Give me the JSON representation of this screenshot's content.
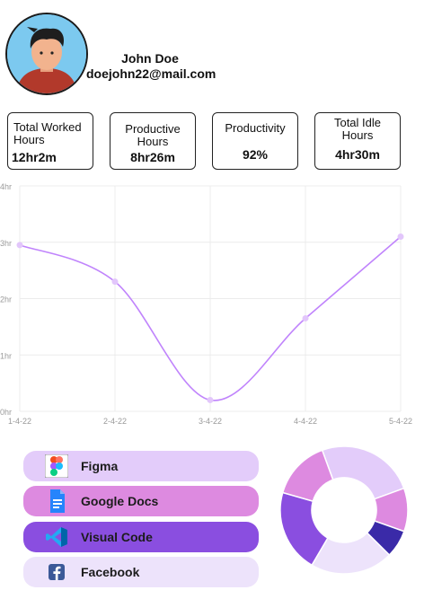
{
  "profile": {
    "name": "John Doe",
    "email": "doejohn22@mail.com",
    "avatar_icon": "avatar-man-icon"
  },
  "stats": [
    {
      "label": "Total Worked Hours",
      "value": "12hr2m"
    },
    {
      "label": "Productive Hours",
      "value": "8hr26m"
    },
    {
      "label": "Productivity",
      "value": "92%"
    },
    {
      "label": "Total Idle Hours",
      "value": "4hr30m"
    }
  ],
  "chart_data": {
    "type": "line",
    "x": [
      "1-4-22",
      "2-4-22",
      "3-4-22",
      "4-4-22",
      "5-4-22"
    ],
    "y_tick_labels": [
      "0hr",
      "1hr",
      "2hr",
      "3hr",
      "4hr"
    ],
    "ylim": [
      0,
      4
    ],
    "series": [
      {
        "values": [
          2.95,
          2.3,
          0.2,
          1.65,
          3.1
        ],
        "color": "#c084fc"
      }
    ],
    "grid": true
  },
  "apps": [
    {
      "name": "Figma",
      "icon": "figma-icon",
      "color": "#e3ccfa"
    },
    {
      "name": "Google Docs",
      "icon": "google-docs-icon",
      "color": "#dd8ae0"
    },
    {
      "name": "Visual Code",
      "icon": "visual-code-icon",
      "color": "#8a4ee0"
    },
    {
      "name": "Facebook",
      "icon": "facebook-icon",
      "color": "#ede3fb"
    }
  ],
  "donut_data": {
    "type": "pie",
    "slices": [
      {
        "value": 25,
        "color": "#e3ccfa"
      },
      {
        "value": 11,
        "color": "#dd8ae0"
      },
      {
        "value": 7,
        "color": "#3a2aa8"
      },
      {
        "value": 21,
        "color": "#ede3fb"
      },
      {
        "value": 21,
        "color": "#8a4ee0"
      },
      {
        "value": 15,
        "color": "#dd8ae0"
      }
    ]
  }
}
